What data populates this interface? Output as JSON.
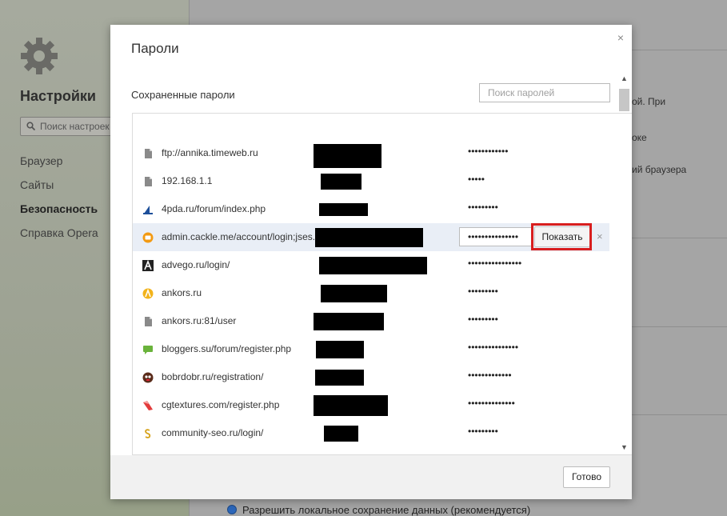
{
  "background": {
    "sidebar_title": "Настройки",
    "sidebar_search_placeholder": "Поиск настроек",
    "nav": [
      {
        "label": "Браузер",
        "active": false
      },
      {
        "label": "Сайты",
        "active": false
      },
      {
        "label": "Безопасность",
        "active": true
      },
      {
        "label": "Справка Opera",
        "active": false
      }
    ],
    "fragments": [
      "ой. При",
      "оке",
      "ий браузера"
    ],
    "radio_label": "Разрешить локальное сохранение данных (рекомендуется)"
  },
  "dialog": {
    "title": "Пароли",
    "close_symbol": "×",
    "subtitle": "Сохраненные пароли",
    "search_placeholder": "Поиск паролей",
    "done_label": "Готово",
    "show_label": "Показать",
    "remove_symbol": "×",
    "scroll_up": "▲",
    "scroll_down": "▼",
    "entries": [
      {
        "site": "ftp://annika.timeweb.ru",
        "password": "••••••••••••",
        "icon": "file-icon",
        "selected": false
      },
      {
        "site": "192.168.1.1",
        "password": "•••••",
        "icon": "file-icon",
        "selected": false
      },
      {
        "site": "4pda.ru/forum/index.php",
        "password": "•••••••••",
        "icon": "4pda-icon",
        "selected": false
      },
      {
        "site": "admin.cackle.me/account/login;jses...",
        "password": "•••••••••••••••",
        "icon": "cackle-icon",
        "selected": true
      },
      {
        "site": "advego.ru/login/",
        "password": "••••••••••••••••",
        "icon": "advego-icon",
        "selected": false
      },
      {
        "site": "ankors.ru",
        "password": "•••••••••",
        "icon": "ankors-icon",
        "selected": false
      },
      {
        "site": "ankors.ru:81/user",
        "password": "•••••••••",
        "icon": "file-icon",
        "selected": false
      },
      {
        "site": "bloggers.su/forum/register.php",
        "password": "•••••••••••••••",
        "icon": "speech-bubble-icon",
        "selected": false
      },
      {
        "site": "bobrdobr.ru/registration/",
        "password": "•••••••••••••",
        "icon": "bobrdobr-icon",
        "selected": false
      },
      {
        "site": "cgtextures.com/register.php",
        "password": "••••••••••••••",
        "icon": "cgtextures-icon",
        "selected": false
      },
      {
        "site": "community-seo.ru/login/",
        "password": "•••••••••",
        "icon": "seo-icon",
        "selected": false
      }
    ]
  }
}
